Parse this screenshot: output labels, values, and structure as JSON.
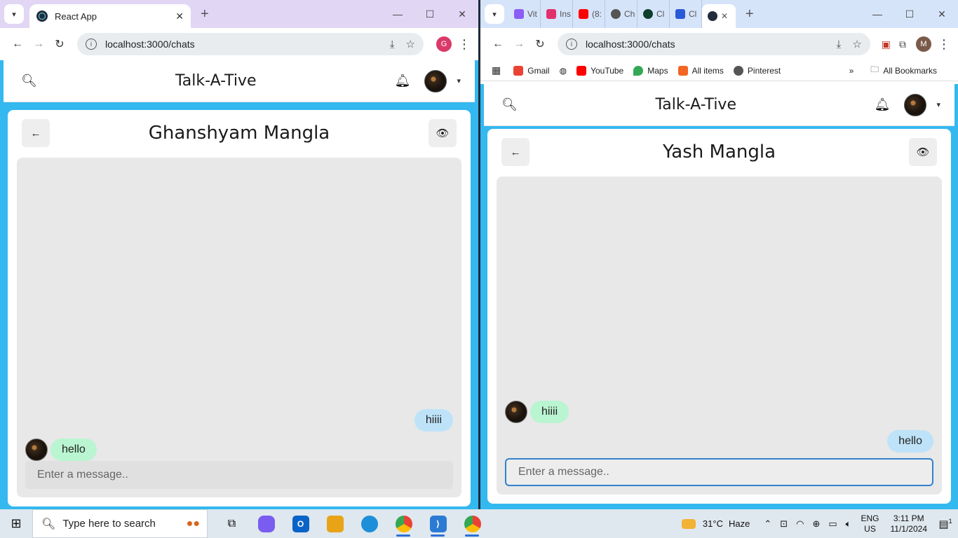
{
  "left_browser": {
    "tab_title": "React App",
    "url": "localhost:3000/chats",
    "profile_initial": "G",
    "profile_color": "#d93a6a"
  },
  "right_browser": {
    "mini_tabs": [
      "Vit",
      "Ins",
      "(8:",
      "Ch",
      "Cl",
      "Cl"
    ],
    "mini_tab_colors": [
      "#8b5cf6",
      "#e1306c",
      "#ff0000",
      "#555555",
      "#0f3d2e",
      "#2a5bd7"
    ],
    "url": "localhost:3000/chats",
    "profile_initial": "M",
    "profile_color": "#7a5a4a",
    "bookmarks": [
      "Gmail",
      "YouTube",
      "Maps",
      "All items",
      "Pinterest"
    ],
    "bookmark_colors": [
      "#ea4335",
      "#ff0000",
      "#34a853",
      "#f26522",
      "#555555"
    ],
    "all_bookmarks": "All Bookmarks"
  },
  "app": {
    "brand": "Talk-A-Tive"
  },
  "left_chat": {
    "contact_name": "Ghanshyam Mangla",
    "messages": [
      {
        "text": "hiiii",
        "mine": true
      },
      {
        "text": "hello",
        "mine": false
      }
    ],
    "input_placeholder": "Enter a message.."
  },
  "right_chat": {
    "contact_name": "Yash Mangla",
    "messages": [
      {
        "text": "hiiii",
        "mine": false
      },
      {
        "text": "hello",
        "mine": true
      }
    ],
    "input_placeholder": "Enter a message.."
  },
  "taskbar": {
    "search_placeholder": "Type here to search",
    "weather_temp": "31°C",
    "weather_desc": "Haze",
    "lang_top": "ENG",
    "lang_bottom": "US",
    "time": "3:11 PM",
    "date": "11/1/2024",
    "notification_count": "1",
    "pinned_colors": [
      "#7a5cf0",
      "#0a64c8",
      "#e8a317",
      "#1c8fd8",
      "#ea4335",
      "#2b7bd5",
      "#e84b3c"
    ]
  }
}
